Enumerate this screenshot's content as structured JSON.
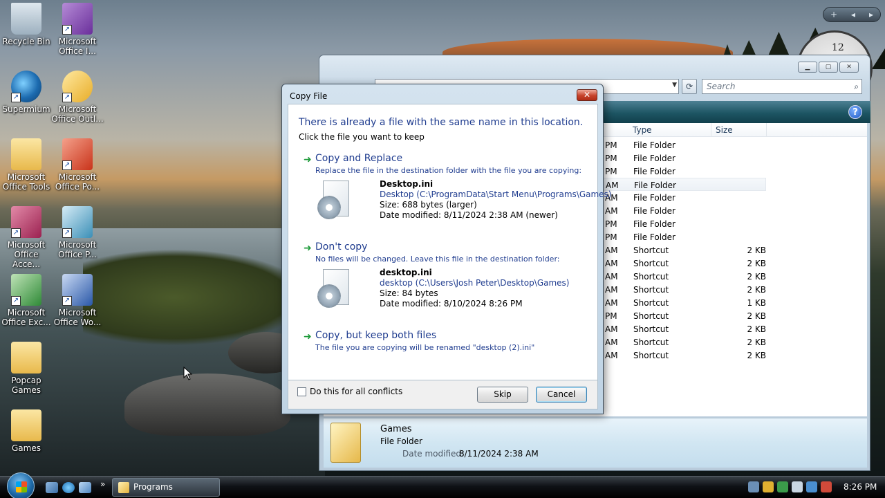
{
  "desktop": {
    "icons": [
      {
        "label": "Recycle Bin",
        "icon": "recycle-bin-icon"
      },
      {
        "label": "Microsoft Office I...",
        "icon": "office-icon"
      },
      {
        "label": "Supermium",
        "icon": "browser-icon"
      },
      {
        "label": "Microsoft Office Outl...",
        "icon": "outlook-icon"
      },
      {
        "label": "Microsoft Office Tools",
        "icon": "folder-icon"
      },
      {
        "label": "Microsoft Office Po...",
        "icon": "powerpoint-icon"
      },
      {
        "label": "Microsoft Office Acce...",
        "icon": "access-icon"
      },
      {
        "label": "Microsoft Office P...",
        "icon": "publisher-icon"
      },
      {
        "label": "Microsoft Office Exc...",
        "icon": "excel-icon"
      },
      {
        "label": "Microsoft Office Wo...",
        "icon": "word-icon"
      },
      {
        "label": "Popcap Games",
        "icon": "folder-icon"
      },
      {
        "label": "Games",
        "icon": "folder-icon"
      }
    ]
  },
  "gadgets": {
    "bar": {
      "add": "+",
      "prev": "◂",
      "next": "▸"
    },
    "clock_label": "12"
  },
  "explorer": {
    "search_placeholder": "Search",
    "columns": {
      "type": "Type",
      "size": "Size"
    },
    "rows": [
      {
        "date_tail": "PM",
        "type": "File Folder",
        "size": ""
      },
      {
        "date_tail": "PM",
        "type": "File Folder",
        "size": ""
      },
      {
        "date_tail": "PM",
        "type": "File Folder",
        "size": ""
      },
      {
        "date_tail": "AM",
        "type": "File Folder",
        "size": ""
      },
      {
        "date_tail": "AM",
        "type": "File Folder",
        "size": ""
      },
      {
        "date_tail": "AM",
        "type": "File Folder",
        "size": ""
      },
      {
        "date_tail": "PM",
        "type": "File Folder",
        "size": ""
      },
      {
        "date_tail": "PM",
        "type": "File Folder",
        "size": ""
      },
      {
        "date_tail": "AM",
        "type": "Shortcut",
        "size": "2 KB"
      },
      {
        "date_tail": "AM",
        "type": "Shortcut",
        "size": "2 KB"
      },
      {
        "date_tail": "AM",
        "type": "Shortcut",
        "size": "2 KB"
      },
      {
        "date_tail": "AM",
        "type": "Shortcut",
        "size": "2 KB"
      },
      {
        "date_tail": "AM",
        "type": "Shortcut",
        "size": "1 KB"
      },
      {
        "date_tail": "PM",
        "type": "Shortcut",
        "size": "2 KB"
      },
      {
        "date_tail": "AM",
        "type": "Shortcut",
        "size": "2 KB"
      },
      {
        "date_tail": "AM",
        "type": "Shortcut",
        "size": "2 KB"
      },
      {
        "date_tail": "AM",
        "type": "Shortcut",
        "size": "2 KB"
      }
    ],
    "selected_row": 3,
    "details": {
      "name": "Games",
      "type": "File Folder",
      "date_label": "Date modified:",
      "date_value": "8/11/2024 2:38 AM"
    }
  },
  "dialog": {
    "title": "Copy File",
    "heading": "There is already a file with the same name in this location.",
    "subheading": "Click the file you want to keep",
    "option_replace": {
      "title": "Copy and Replace",
      "desc": "Replace the file in the destination folder with the file you are copying:",
      "file_name": "Desktop.ini",
      "file_path": "Desktop (C:\\ProgramData\\Start Menu\\Programs\\Games)",
      "file_size": "Size: 688 bytes (larger)",
      "file_date": "Date modified: 8/11/2024 2:38 AM (newer)"
    },
    "option_dont_copy": {
      "title": "Don't copy",
      "desc": "No files will be changed. Leave this file in the destination folder:",
      "file_name": "desktop.ini",
      "file_path": "desktop (C:\\Users\\Josh Peter\\Desktop\\Games)",
      "file_size": "Size: 84 bytes",
      "file_date": "Date modified: 8/10/2024 8:26 PM"
    },
    "option_keep_both": {
      "title": "Copy, but keep both files",
      "desc": "The file you are copying will be renamed \"desktop (2).ini\""
    },
    "checkbox_label": "Do this for all conflicts",
    "skip_label": "Skip",
    "cancel_label": "Cancel"
  },
  "taskbar": {
    "task_label": "Programs",
    "time": "8:26 PM"
  }
}
